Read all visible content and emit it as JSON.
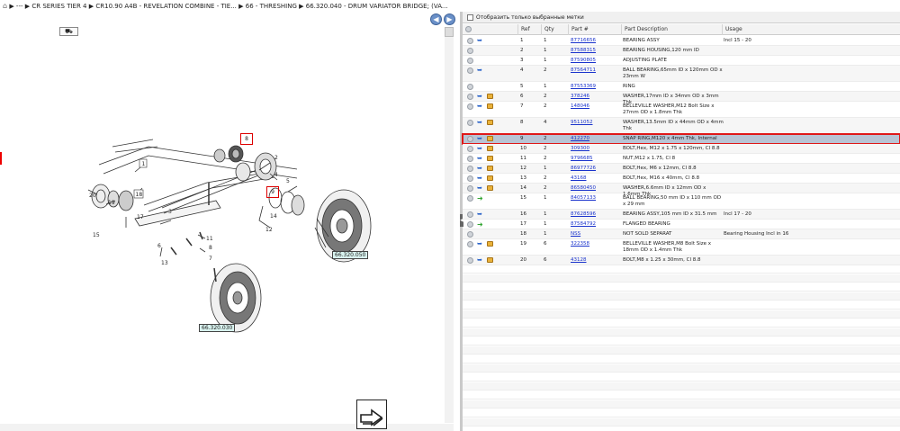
{
  "breadcrumb": {
    "items": [
      "---",
      "CR SERIES TIER 4",
      "CR10.90 A4B - REVELATION COMBINE - TIE...",
      "66 - THRESHING",
      "66.320.040 - DRUM VARIATOR BRIDGE; (VA..."
    ]
  },
  "diagram": {
    "callouts": [
      "66.320.050",
      "66.320.030"
    ],
    "highlight_label_top": "8",
    "highlight_label_mid": "9",
    "labels": [
      "1",
      "2",
      "3",
      "4",
      "5",
      "6",
      "7",
      "8",
      "12",
      "13",
      "14",
      "15",
      "17",
      "18",
      "19",
      "20",
      "11"
    ]
  },
  "filter": {
    "label": "Отобразить только выбранные метки"
  },
  "table": {
    "headers": [
      "Ref",
      "Qty",
      "Part #",
      "Part Description",
      "Usage"
    ],
    "rows": [
      {
        "ref": "1",
        "qty": "1",
        "pn": "87716656",
        "desc": "BEARING ASSY",
        "usage": "Incl 15 - 20",
        "icons": "cb"
      },
      {
        "ref": "2",
        "qty": "1",
        "pn": "87588315",
        "desc": "BEARING HOUSING,120 mm   ID",
        "usage": "",
        "icons": "c"
      },
      {
        "ref": "3",
        "qty": "1",
        "pn": "87590805",
        "desc": "ADJUSTING PLATE",
        "usage": "",
        "icons": "c"
      },
      {
        "ref": "4",
        "qty": "2",
        "pn": "87564711",
        "desc": "BALL BEARING,65mm ID x 120mm OD x 23mm W",
        "usage": "",
        "icons": "cb"
      },
      {
        "ref": "5",
        "qty": "1",
        "pn": "87553369",
        "desc": "RING",
        "usage": "",
        "icons": "c"
      },
      {
        "ref": "6",
        "qty": "2",
        "pn": "378246",
        "desc": "WASHER,17mm ID x 34mm OD x 3mm Thk",
        "usage": "",
        "icons": "cbx"
      },
      {
        "ref": "7",
        "qty": "2",
        "pn": "148046",
        "desc": "BELLEVILLE WASHER,M12 Bolt Size x 27mm OD x 1.8mm Thk",
        "usage": "",
        "icons": "cbx"
      },
      {
        "ref": "8",
        "qty": "4",
        "pn": "9511052",
        "desc": "WASHER,13.5mm ID x 44mm OD x 4mm Thk",
        "usage": "",
        "icons": "cbx"
      },
      {
        "ref": "9",
        "qty": "2",
        "pn": "412270",
        "desc": "SNAP RING,M120 x 4mm Thk, Internal",
        "usage": "",
        "icons": "cbx",
        "selected": true
      },
      {
        "ref": "10",
        "qty": "2",
        "pn": "309300",
        "desc": "BOLT,Hex, M12 x 1.75 x 120mm, Cl 8.8",
        "usage": "",
        "icons": "cbx"
      },
      {
        "ref": "11",
        "qty": "2",
        "pn": "9796685",
        "desc": "NUT,M12 x 1.75, Cl 8",
        "usage": "",
        "icons": "cbx"
      },
      {
        "ref": "12",
        "qty": "1",
        "pn": "86977726",
        "desc": "BOLT,Hex, M6 x 12mm, Cl 8.8",
        "usage": "",
        "icons": "cbx"
      },
      {
        "ref": "13",
        "qty": "2",
        "pn": "43168",
        "desc": "BOLT,Hex, M16 x 40mm, Cl 8.8",
        "usage": "",
        "icons": "cbx"
      },
      {
        "ref": "14",
        "qty": "2",
        "pn": "86580450",
        "desc": "WASHER,6.6mm ID x 12mm OD x 1.6mm Thk",
        "usage": "",
        "icons": "cbx"
      },
      {
        "ref": "15",
        "qty": "1",
        "pn": "84057133",
        "desc": "BALL BEARING,50 mm   ID x 110 mm   OD x 29 mm",
        "usage": "",
        "icons": "ca"
      },
      {
        "ref": "16",
        "qty": "1",
        "pn": "87628596",
        "desc": "BEARING ASSY,105 mm   ID x 31.5 mm",
        "usage": "Incl 17 - 20",
        "icons": "cb"
      },
      {
        "ref": "17",
        "qty": "1",
        "pn": "87584792",
        "desc": "FLANGED BEARING",
        "usage": "",
        "icons": "ca"
      },
      {
        "ref": "18",
        "qty": "1",
        "pn": "NSS",
        "desc": "NOT SOLD SEPARAT",
        "usage": "Bearing Housing Incl in 16",
        "icons": "c"
      },
      {
        "ref": "19",
        "qty": "6",
        "pn": "322358",
        "desc": "BELLEVILLE WASHER,M8 Bolt Size x 18mm OD x 1.4mm Thk",
        "usage": "",
        "icons": "cbx"
      },
      {
        "ref": "20",
        "qty": "6",
        "pn": "43128",
        "desc": "BOLT,M8 x 1.25 x 30mm, Cl 8.8",
        "usage": "",
        "icons": "cbx"
      }
    ]
  }
}
